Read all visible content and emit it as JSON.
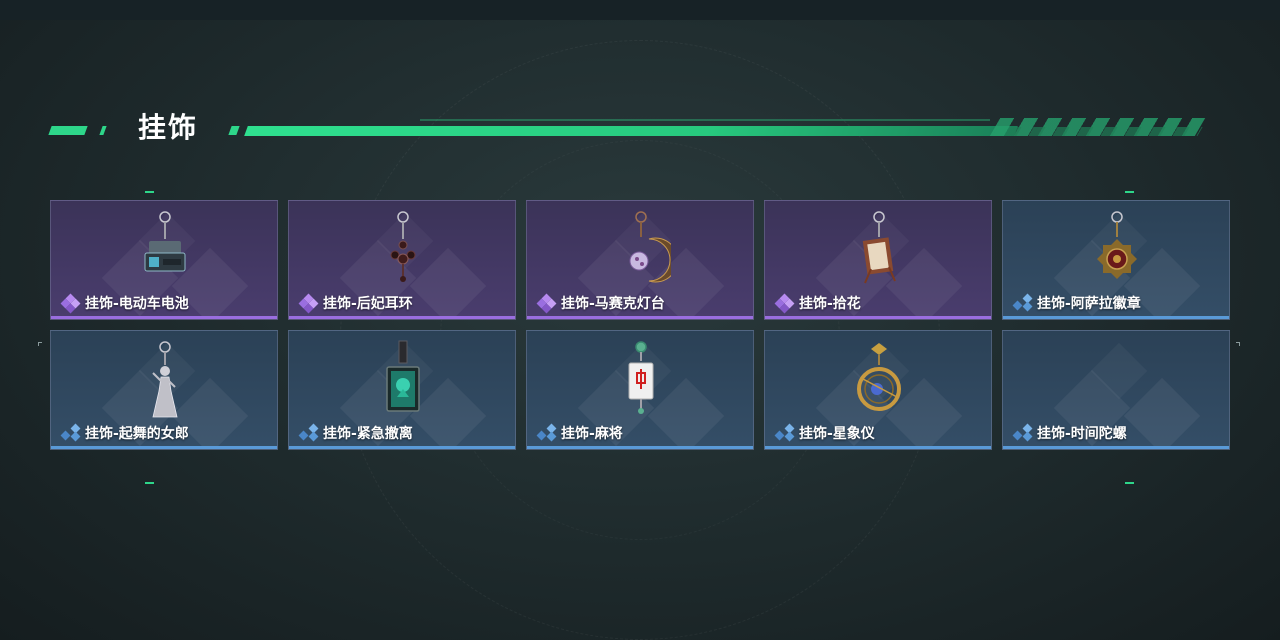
{
  "section": {
    "title": "挂饰"
  },
  "colors": {
    "accent": "#2ed68a",
    "purple_rarity": "#9a6ee0",
    "blue_rarity": "#5a9ad8"
  },
  "items": [
    {
      "name": "挂饰-电动车电池",
      "rarity": "purple",
      "icon": "ebike-battery-charm-icon"
    },
    {
      "name": "挂饰-后妃耳环",
      "rarity": "purple",
      "icon": "consort-earring-charm-icon"
    },
    {
      "name": "挂饰-马赛克灯台",
      "rarity": "purple",
      "icon": "mosaic-lamp-charm-icon"
    },
    {
      "name": "挂饰-拾花",
      "rarity": "purple",
      "icon": "picking-flowers-frame-charm-icon"
    },
    {
      "name": "挂饰-阿萨拉徽章",
      "rarity": "blue",
      "icon": "asala-badge-charm-icon"
    },
    {
      "name": "挂饰-起舞的女郎",
      "rarity": "blue",
      "icon": "dancing-lady-charm-icon"
    },
    {
      "name": "挂饰-紧急撤离",
      "rarity": "blue",
      "icon": "emergency-evac-charm-icon"
    },
    {
      "name": "挂饰-麻将",
      "rarity": "blue",
      "icon": "mahjong-tile-charm-icon"
    },
    {
      "name": "挂饰-星象仪",
      "rarity": "blue",
      "icon": "astrolabe-charm-icon"
    },
    {
      "name": "挂饰-时间陀螺",
      "rarity": "blue",
      "icon": "time-spinning-top-charm-icon"
    }
  ]
}
